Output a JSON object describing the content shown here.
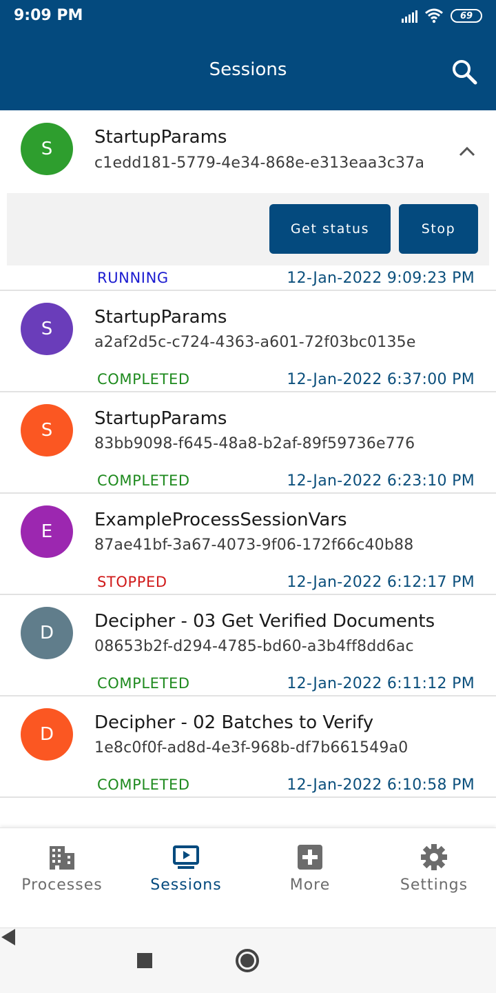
{
  "status_bar": {
    "time": "9:09 PM",
    "battery": "69"
  },
  "app_bar": {
    "title": "Sessions",
    "search_icon": "search-icon"
  },
  "expanded_actions": {
    "get_status_label": "Get status",
    "stop_label": "Stop"
  },
  "sessions": [
    {
      "initial": "S",
      "color": "#2e9e2e",
      "name": "StartupParams",
      "id": "c1edd181-5779-4e34-868e-e313eaa3c37a",
      "status": "RUNNING",
      "status_color": "#1b1bd0",
      "date": "12-Jan-2022 9:09:23 PM",
      "expanded": true
    },
    {
      "initial": "S",
      "color": "#6a3dba",
      "name": "StartupParams",
      "id": "a2af2d5c-c724-4363-a601-72f03bc0135e",
      "status": "COMPLETED",
      "status_color": "#1e8a1e",
      "date": "12-Jan-2022 6:37:00 PM"
    },
    {
      "initial": "S",
      "color": "#fb5722",
      "name": "StartupParams",
      "id": "83bb9098-f645-48a8-b2af-89f59736e776",
      "status": "COMPLETED",
      "status_color": "#1e8a1e",
      "date": "12-Jan-2022 6:23:10 PM"
    },
    {
      "initial": "E",
      "color": "#9c27b0",
      "name": "ExampleProcessSessionVars",
      "id": "87ae41bf-3a67-4073-9f06-172f66c40b88",
      "status": "STOPPED",
      "status_color": "#d01a1a",
      "date": "12-Jan-2022 6:12:17 PM"
    },
    {
      "initial": "D",
      "color": "#607d8b",
      "name": "Decipher - 03 Get Verified Documents",
      "id": "08653b2f-d294-4785-bd60-a3b4ff8dd6ac",
      "status": "COMPLETED",
      "status_color": "#1e8a1e",
      "date": "12-Jan-2022 6:11:12 PM"
    },
    {
      "initial": "D",
      "color": "#fb5722",
      "name": "Decipher - 02 Batches to Verify",
      "id": "1e8c0f0f-ad8d-4e3f-968b-df7b661549a0",
      "status": "COMPLETED",
      "status_color": "#1e8a1e",
      "date": "12-Jan-2022 6:10:58 PM"
    }
  ],
  "bottom_nav": [
    {
      "label": "Processes",
      "icon": "building-icon",
      "active": false
    },
    {
      "label": "Sessions",
      "icon": "monitor-play-icon",
      "active": true
    },
    {
      "label": "More",
      "icon": "plus-box-icon",
      "active": false
    },
    {
      "label": "Settings",
      "icon": "gear-icon",
      "active": false
    }
  ],
  "colors": {
    "primary": "#044a7e",
    "date_text": "#0b4f7c"
  }
}
